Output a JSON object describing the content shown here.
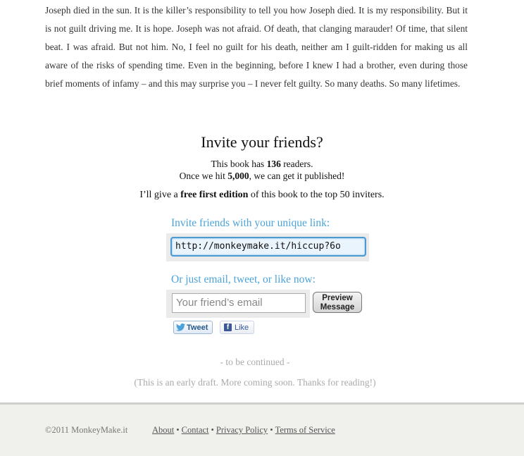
{
  "story": {
    "text": "Joseph died in the sun. It is the killer’s responsibility to tell you how Joseph died. It is my responsibility. But it is not guilt driving me. It is hope. Joseph was not afraid. Of death, that clanging marauder! Of time, that silent beat. I was afraid. But not him. No, I feel no guilt for his death, neither am I guilt-ridden for making us all aware of the risks of spending time. Even in the beginning, before I knew I had a brother, even during those brief moments of infamy – and this may surprise you – I never felt guilty. So many deaths. So many lifetimes."
  },
  "invite": {
    "title": "Invite your friends?",
    "readers_prefix": "This book has ",
    "readers_count": "136",
    "readers_suffix": " readers.",
    "goal_prefix": "Once we hit ",
    "goal_count": "5,000",
    "goal_suffix": ", we can get it published!",
    "offer_prefix": "I’ll give a ",
    "offer_bold": "free first edition",
    "offer_suffix": " of this book to the top 50 inviters."
  },
  "link_section": {
    "label": "Invite friends with your unique link:",
    "url": "http://monkeymake.it/hiccup?6o"
  },
  "email_section": {
    "label": "Or just email, tweet, or like now:",
    "placeholder": "Your friend’s email",
    "preview_line1": "Preview",
    "preview_line2": "Message",
    "tweet_label": "Tweet",
    "like_label": "Like"
  },
  "end": {
    "continued": "- to be continued -",
    "note": "(This is an early draft. More coming soon. Thanks for reading!)"
  },
  "footer": {
    "copyright": "©2011 MonkeyMake.it",
    "links": [
      "About",
      "Contact",
      "Privacy Policy",
      "Terms of Service"
    ],
    "separator": "•"
  },
  "colors": {
    "accent_blue": "#4aa3d8",
    "footer_bg": "#f0f0ec"
  }
}
